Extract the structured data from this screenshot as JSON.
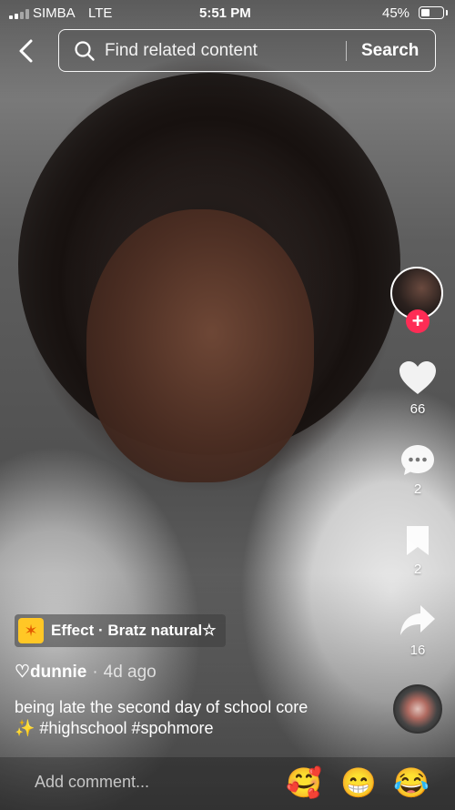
{
  "status_bar": {
    "carrier": "SIMBA",
    "network": "LTE",
    "time": "5:51 PM",
    "battery_percent": "45%",
    "battery_level": 0.45
  },
  "search": {
    "placeholder": "Find related content",
    "button_label": "Search"
  },
  "actions": {
    "likes": "66",
    "comments": "2",
    "favorites": "2",
    "shares": "16",
    "follow_symbol": "+"
  },
  "effect": {
    "label": "Effect · Bratz natural☆",
    "icon": "sparkle-wand-icon"
  },
  "post": {
    "author": "♡dunnie",
    "separator": "·",
    "time_ago": "4d ago",
    "caption": "being late the second day of school core ✨ #highschool #spohmore"
  },
  "comment_bar": {
    "placeholder": "Add comment...",
    "emojis": [
      "🥰",
      "😁",
      "😂"
    ]
  },
  "colors": {
    "follow_red": "#fe2c55",
    "effect_yellow": "#ffc726"
  }
}
